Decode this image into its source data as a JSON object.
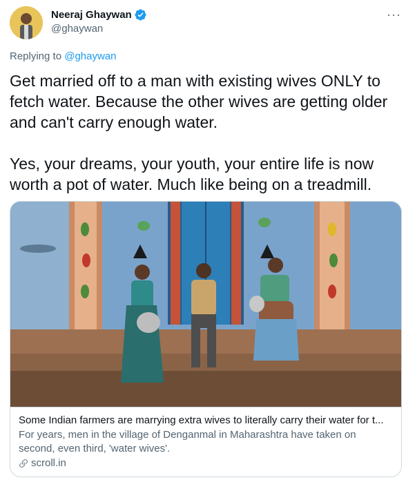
{
  "author": {
    "display_name": "Neeraj Ghaywan",
    "handle": "@ghaywan",
    "verified_icon": "verified-badge-icon",
    "avatar_bg": "#e8c45a"
  },
  "reply": {
    "prefix": "Replying to ",
    "mention": "@ghaywan"
  },
  "tweet": {
    "paragraph_1": "Get married off to a man with existing wives ONLY to fetch water. Because the other wives are getting older and can't carry enough water.",
    "paragraph_2": "Yes, your dreams, your youth, your entire life is now worth a pot of water. Much like being on a treadmill."
  },
  "card": {
    "title": "Some Indian farmers are marrying extra wives to literally carry their water for t...",
    "description": "For years, men in the village of Denganmal in Maharashtra have taken on second, even third, 'water wives'.",
    "domain": "scroll.in",
    "link_icon": "link-icon"
  },
  "colors": {
    "accent": "#1d9bf0",
    "secondary_text": "#536471",
    "border": "#cfd9de"
  }
}
